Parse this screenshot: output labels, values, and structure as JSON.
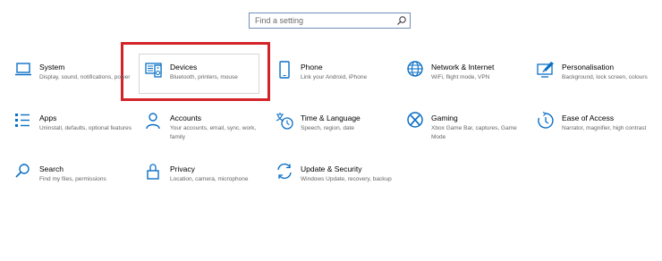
{
  "search": {
    "placeholder": "Find a setting"
  },
  "accent_color": "#0b6fc5",
  "highlight_color": "#d42328",
  "categories": [
    {
      "title": "System",
      "description": "Display, sound, notifications, power",
      "icon": "laptop-icon"
    },
    {
      "title": "Devices",
      "description": "Bluetooth, printers, mouse",
      "icon": "keyboard-speaker-icon"
    },
    {
      "title": "Phone",
      "description": "Link your Android, iPhone",
      "icon": "phone-icon"
    },
    {
      "title": "Network & Internet",
      "description": "WiFi, flight mode, VPN",
      "icon": "globe-icon"
    },
    {
      "title": "Personalisation",
      "description": "Background, lock screen, colours",
      "icon": "paint-brush-icon"
    },
    {
      "title": "Apps",
      "description": "Uninstall, defaults, optional features",
      "icon": "apps-list-icon"
    },
    {
      "title": "Accounts",
      "description": "Your accounts, email, sync, work, family",
      "icon": "person-icon"
    },
    {
      "title": "Time & Language",
      "description": "Speech, region, date",
      "icon": "time-language-icon"
    },
    {
      "title": "Gaming",
      "description": "Xbox Game Bar, captures, Game Mode",
      "icon": "xbox-icon"
    },
    {
      "title": "Ease of Access",
      "description": "Narrator, magnifier, high contrast",
      "icon": "ease-of-access-icon"
    },
    {
      "title": "Search",
      "description": "Find my files, permissions",
      "icon": "search-icon"
    },
    {
      "title": "Privacy",
      "description": "Location, camera, microphone",
      "icon": "lock-icon"
    },
    {
      "title": "Update & Security",
      "description": "Windows Update, recovery, backup",
      "icon": "update-sync-icon"
    }
  ]
}
